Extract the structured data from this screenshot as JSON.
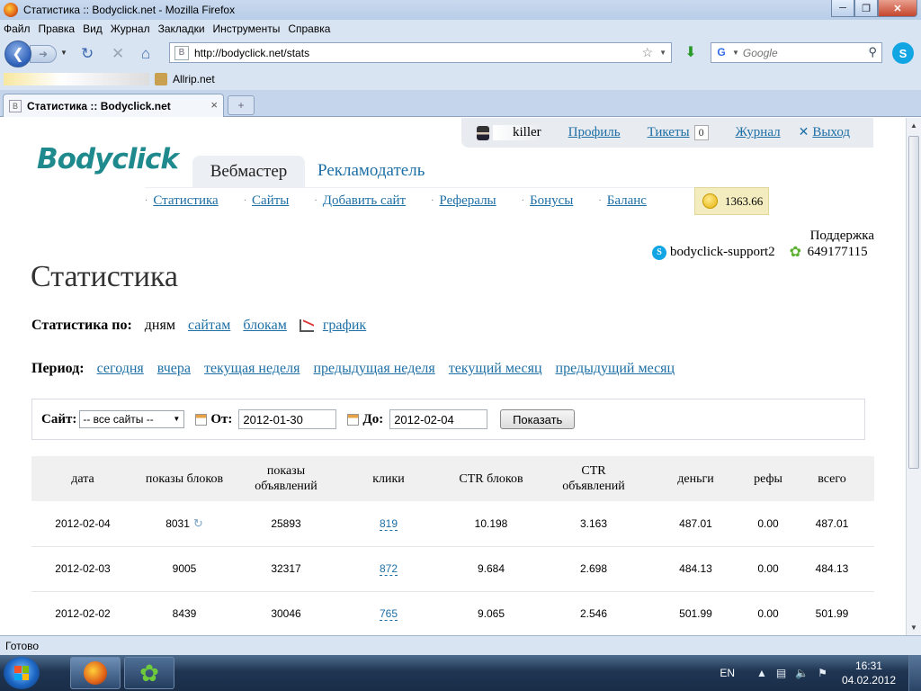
{
  "window": {
    "title": "Статистика :: Bodyclick.net - Mozilla Firefox"
  },
  "menu": [
    "Файл",
    "Правка",
    "Вид",
    "Журнал",
    "Закладки",
    "Инструменты",
    "Справка"
  ],
  "toolbar": {
    "url": "http://bodyclick.net/stats",
    "search_placeholder": "Google",
    "site_icon_letter": "B"
  },
  "bookmarks": {
    "items": [
      {
        "label": "Allrip.net"
      }
    ]
  },
  "tabs": {
    "active_title": "Статистика :: Bodyclick.net",
    "new_tab_symbol": "+"
  },
  "site": {
    "logo": "Bodyclick",
    "user": {
      "name": "killer",
      "profile": "Профиль",
      "tickets": "Тикеты",
      "tickets_count": "0",
      "journal": "Журнал",
      "logout": "Выход"
    },
    "main_tabs": {
      "active": "Вебмастер",
      "other": "Рекламодатель"
    },
    "subnav": [
      "Статистика",
      "Сайты",
      "Добавить сайт",
      "Рефералы",
      "Бонусы",
      "Баланс"
    ],
    "balance": "1363.66",
    "support": {
      "label": "Поддержка",
      "skype": "bodyclick-support2",
      "icq": "649177115"
    }
  },
  "page": {
    "title": "Статистика",
    "stats_by": {
      "label": "Статистика по:",
      "current": "дням",
      "sites": "сайтам",
      "blocks": "блокам",
      "chart": "график"
    },
    "period": {
      "label": "Период:",
      "options": [
        "сегодня",
        "вчера",
        "текущая неделя",
        "предыдущая неделя",
        "текущий месяц",
        "предыдущий месяц"
      ]
    },
    "filter": {
      "site_label": "Сайт:",
      "site_value": "-- все сайты --",
      "from_label": "От:",
      "from_value": "2012-01-30",
      "to_label": "До:",
      "to_value": "2012-02-04",
      "submit": "Показать"
    },
    "table": {
      "headers": [
        "дата",
        "показы блоков",
        "показы объявлений",
        "клики",
        "CTR блоков",
        "CTR объявлений",
        "деньги",
        "рефы",
        "всего"
      ],
      "rows": [
        [
          "2012-02-04",
          "8031",
          "25893",
          "819",
          "10.198",
          "3.163",
          "487.01",
          "0.00",
          "487.01"
        ],
        [
          "2012-02-03",
          "9005",
          "32317",
          "872",
          "9.684",
          "2.698",
          "484.13",
          "0.00",
          "484.13"
        ],
        [
          "2012-02-02",
          "8439",
          "30046",
          "765",
          "9.065",
          "2.546",
          "501.99",
          "0.00",
          "501.99"
        ]
      ]
    }
  },
  "statusbar": {
    "text": "Готово"
  },
  "taskbar": {
    "lang": "EN",
    "time": "16:31",
    "date": "04.02.2012"
  },
  "colors": {
    "link": "#1d6fa5",
    "logo": "#1e8a8d",
    "balance_bg": "#f3ecbe"
  }
}
